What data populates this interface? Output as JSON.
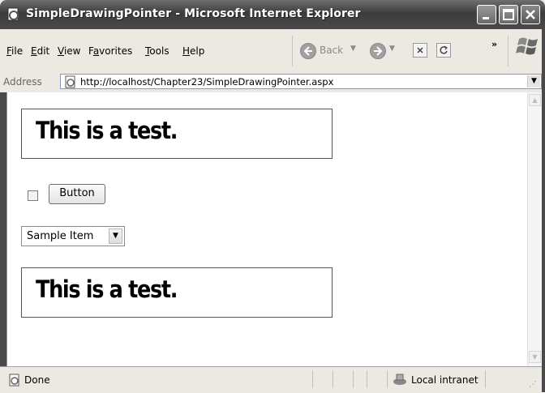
{
  "window": {
    "title": "SimpleDrawingPointer - Microsoft Internet Explorer"
  },
  "menu": {
    "items": [
      {
        "label": "File",
        "accel": "F",
        "rest": "ile"
      },
      {
        "label": "Edit",
        "accel": "E",
        "rest": "dit"
      },
      {
        "label": "View",
        "accel": "V",
        "rest": "iew"
      },
      {
        "label": "Favorites",
        "pre": "F",
        "accel": "a",
        "rest": "vorites"
      },
      {
        "label": "Tools",
        "accel": "T",
        "rest": "ools"
      },
      {
        "label": "Help",
        "accel": "H",
        "rest": "elp"
      }
    ],
    "back_label": "Back",
    "overflow": "»"
  },
  "address": {
    "label": "Address",
    "url": "http://localhost/Chapter23/SimpleDrawingPointer.aspx"
  },
  "content": {
    "test_text_1": "This is a test.",
    "button_label": "Button",
    "select_value": "Sample Item",
    "test_text_2": "This is a test.",
    "checkbox_checked": false
  },
  "status": {
    "text": "Done",
    "zone": "Local intranet"
  },
  "icons": {
    "title": "ie-page-icon",
    "back": "back-arrow-icon",
    "forward": "forward-arrow-icon",
    "stop": "stop-icon",
    "refresh": "refresh-icon",
    "logo": "windows-logo-icon",
    "status": "ie-page-icon",
    "zone": "local-intranet-icon"
  }
}
